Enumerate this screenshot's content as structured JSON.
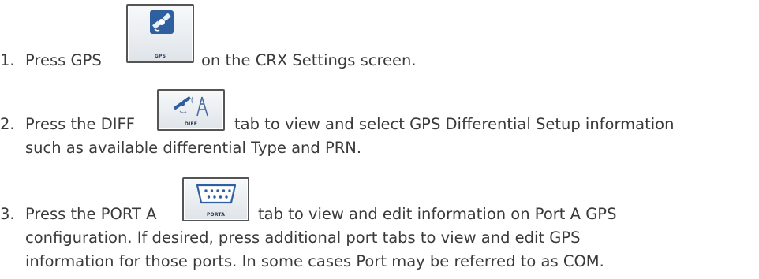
{
  "steps": [
    {
      "number": "1.",
      "before": "Press GPS",
      "button_label": "GPS",
      "button_icon": "gps-satellite-icon",
      "after": "on the CRX Settings screen."
    },
    {
      "number": "2.",
      "before": "Press the DIFF",
      "button_label": "DIFF",
      "button_icon": "differential-satellite-tower-icon",
      "after": "tab to view and select GPS Differential Setup information",
      "continuation": [
        "such as available differential Type and PRN."
      ]
    },
    {
      "number": "3.",
      "before": "Press the PORT A",
      "button_label": "PORTA",
      "button_icon": "serial-port-icon",
      "after": "tab to view and edit information on Port A GPS",
      "continuation": [
        "configuration. If desired, press additional port tabs to view and edit GPS",
        "information for those ports. In some cases Port may be referred to as COM."
      ]
    }
  ],
  "colors": {
    "text": "#3a3a3a",
    "button_border": "#555555",
    "icon_blue": "#2f5f9e"
  }
}
